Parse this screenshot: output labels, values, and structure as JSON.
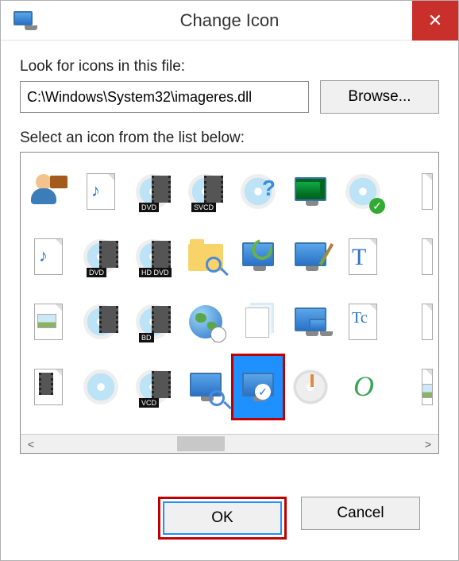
{
  "title": "Change Icon",
  "close_symbol": "✕",
  "labels": {
    "look": "Look for icons in this file:",
    "select": "Select an icon from the list below:"
  },
  "path_value": "C:\\Windows\\System32\\imageres.dll",
  "buttons": {
    "browse": "Browse...",
    "ok": "OK",
    "cancel": "Cancel"
  },
  "scroll": {
    "left": "<",
    "right": ">"
  },
  "selected_index": 28,
  "icons": [
    {
      "name": "user-briefcase-icon"
    },
    {
      "name": "music-file-icon"
    },
    {
      "name": "dvd-video-disc-icon",
      "badge": "DVD"
    },
    {
      "name": "svcd-video-disc-icon",
      "badge": "SVCD"
    },
    {
      "name": "disc-help-icon"
    },
    {
      "name": "system-monitor-activity-icon"
    },
    {
      "name": "disc-check-icon"
    },
    {
      "name": "edge-blank-icon"
    },
    {
      "name": "audio-file-icon"
    },
    {
      "name": "dvd-video-disc-alt-icon",
      "badge": "DVD"
    },
    {
      "name": "hddvd-video-disc-icon",
      "badge": "HD DVD"
    },
    {
      "name": "folder-inspect-icon"
    },
    {
      "name": "refresh-monitor-icon"
    },
    {
      "name": "display-personalize-icon"
    },
    {
      "name": "truetype-font-file-icon",
      "glyph": "T"
    },
    {
      "name": "edge-blank-2-icon"
    },
    {
      "name": "image-file-icon"
    },
    {
      "name": "video-disc-icon"
    },
    {
      "name": "bd-video-disc-icon",
      "badge": "BD"
    },
    {
      "name": "globe-time-icon"
    },
    {
      "name": "documents-stack-icon"
    },
    {
      "name": "display-resolution-icon"
    },
    {
      "name": "font-collection-icon",
      "glyph": "Tc"
    },
    {
      "name": "edge-info-icon"
    },
    {
      "name": "video-file-icon"
    },
    {
      "name": "disc-plain-icon"
    },
    {
      "name": "vcd-video-disc-icon",
      "badge": "VCD"
    },
    {
      "name": "monitor-search-icon"
    },
    {
      "name": "windows-experience-monitor-icon"
    },
    {
      "name": "gauge-disc-icon"
    },
    {
      "name": "opera-icon"
    },
    {
      "name": "edge-picture-icon"
    }
  ]
}
